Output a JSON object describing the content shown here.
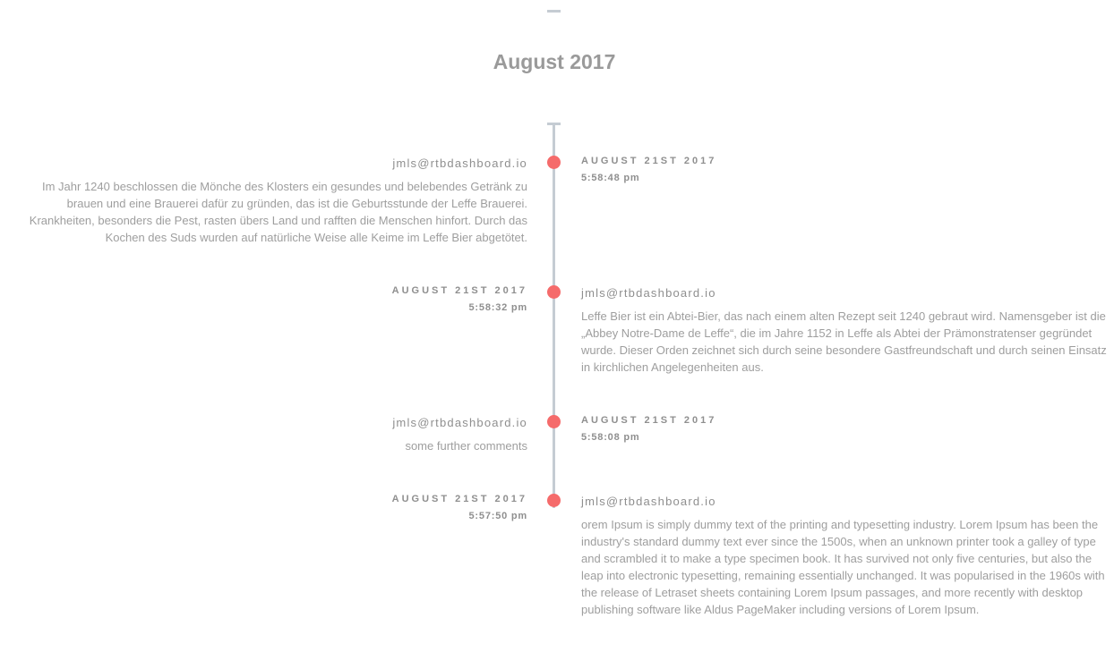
{
  "month": "August 2017",
  "accent_color": "#f56b6b",
  "line_color": "#c5ccd3",
  "entries": [
    {
      "author": "jmls@rtbdashboard.io",
      "date": "AUGUST 21ST 2017",
      "time": "5:58:48 pm",
      "comment": "Im Jahr 1240 beschlossen die Mönche des Klosters ein gesundes und belebendes Getränk zu brauen und eine Brauerei dafür zu gründen, das ist die Geburtsstunde der Leffe Brauerei. Krankheiten, besonders die Pest, rasten übers Land und rafften die Menschen hinfort. Durch das Kochen des Suds wurden auf natürliche Weise alle Keime im Leffe Bier abgetötet."
    },
    {
      "author": "jmls@rtbdashboard.io",
      "date": "AUGUST 21ST 2017",
      "time": "5:58:32 pm",
      "comment": "Leffe Bier ist ein Abtei-Bier, das nach einem alten Rezept seit 1240 gebraut wird. Namensgeber ist die „Abbey Notre-Dame de Leffe“, die im Jahre 1152 in Leffe als Abtei der Prämonstratenser gegründet wurde. Dieser Orden zeichnet sich durch seine besondere Gastfreundschaft und durch seinen Einsatz in kirchlichen Angelegenheiten aus."
    },
    {
      "author": "jmls@rtbdashboard.io",
      "date": "AUGUST 21ST 2017",
      "time": "5:58:08 pm",
      "comment": "some further comments"
    },
    {
      "author": "jmls@rtbdashboard.io",
      "date": "AUGUST 21ST 2017",
      "time": "5:57:50 pm",
      "comment": "orem Ipsum is simply dummy text of the printing and typesetting industry. Lorem Ipsum has been the industry's standard dummy text ever since the 1500s, when an unknown printer took a galley of type and scrambled it to make a type specimen book. It has survived not only five centuries, but also the leap into electronic typesetting, remaining essentially unchanged. It was popularised in the 1960s with the release of Letraset sheets containing Lorem Ipsum passages, and more recently with desktop publishing software like Aldus PageMaker including versions of Lorem Ipsum."
    }
  ]
}
